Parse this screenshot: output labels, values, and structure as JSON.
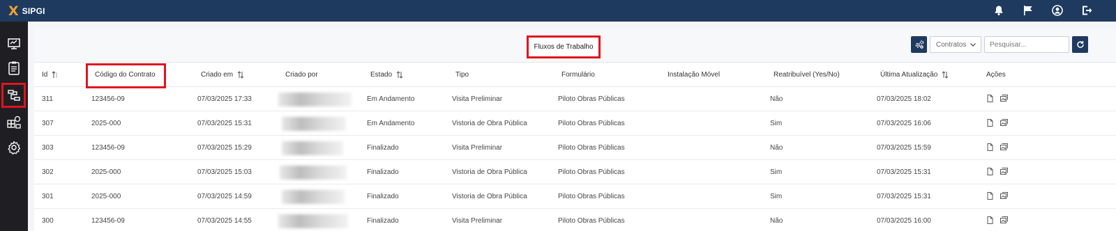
{
  "app": {
    "logo_mark": "X",
    "name": "SIPGI"
  },
  "topbar": {
    "icons": [
      "bell-icon",
      "flag-icon",
      "user-icon",
      "logout-icon"
    ]
  },
  "sidebar": {
    "items": [
      "dashboard-icon",
      "clipboard-icon",
      "workflow-icon",
      "modules-icon",
      "gear-icon"
    ],
    "active": "workflow-icon"
  },
  "page": {
    "title": "Fluxos de Trabalho"
  },
  "toolbar": {
    "select_value": "Contratos",
    "search_placeholder": "Pesquisar..."
  },
  "colors": {
    "topbar": "#1e3a5f",
    "sidebar": "#1f1f23",
    "highlight": "#e0141e",
    "logo_accent": "#f0a030"
  },
  "table": {
    "headers": {
      "id": "Id",
      "contract": "Código do Contrato",
      "created_at": "Criado em",
      "created_by": "Criado por",
      "state": "Estado",
      "type": "Tipo",
      "form": "Formulário",
      "mobile": "Instalação Móvel",
      "reassign": "Reatribuível (Yes/No)",
      "updated": "Última Atualização",
      "actions": "Ações"
    },
    "rows": [
      {
        "id": "311",
        "contract": "123456-09",
        "created_at": "07/03/2025 17:33",
        "state": "Em Andamento",
        "type": "Visita Preliminar",
        "form": "Piloto Obras Públicas",
        "mobile": "",
        "reassign": "Não",
        "updated": "07/03/2025 18:02"
      },
      {
        "id": "307",
        "contract": "2025-000",
        "created_at": "07/03/2025 15:31",
        "state": "Em Andamento",
        "type": "Vistoria de Obra Pública",
        "form": "Piloto Obras Públicas",
        "mobile": "",
        "reassign": "Sim",
        "updated": "07/03/2025 16:06"
      },
      {
        "id": "303",
        "contract": "123456-09",
        "created_at": "07/03/2025 15:29",
        "state": "Finalizado",
        "type": "Visita Preliminar",
        "form": "Piloto Obras Públicas",
        "mobile": "",
        "reassign": "Não",
        "updated": "07/03/2025 15:59"
      },
      {
        "id": "302",
        "contract": "2025-000",
        "created_at": "07/03/2025 15:03",
        "state": "Finalizado",
        "type": "Vistoria de Obra Pública",
        "form": "Piloto Obras Públicas",
        "mobile": "",
        "reassign": "Sim",
        "updated": "07/03/2025 15:31"
      },
      {
        "id": "301",
        "contract": "2025-000",
        "created_at": "07/03/2025 14:59",
        "state": "Finalizado",
        "type": "Vistoria de Obra Pública",
        "form": "Piloto Obras Públicas",
        "mobile": "",
        "reassign": "Sim",
        "updated": "07/03/2025 15:31"
      },
      {
        "id": "300",
        "contract": "123456-09",
        "created_at": "07/03/2025 14:55",
        "state": "Finalizado",
        "type": "Visita Preliminar",
        "form": "Piloto Obras Públicas",
        "mobile": "",
        "reassign": "Não",
        "updated": "07/03/2025 16:00"
      }
    ]
  }
}
